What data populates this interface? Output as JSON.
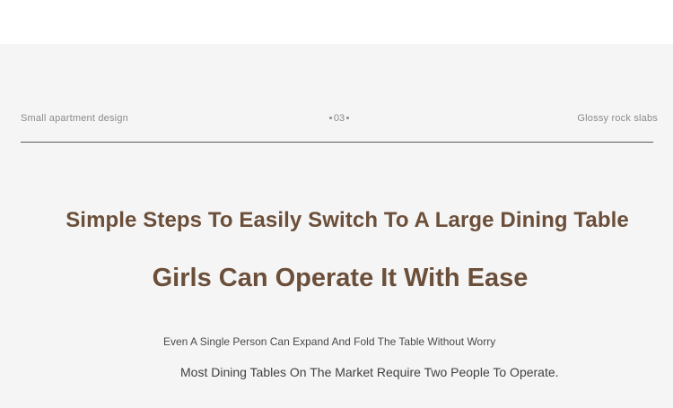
{
  "header": {
    "left_label": "Small apartment design",
    "page_number": "03",
    "right_label": "Glossy rock slabs"
  },
  "content": {
    "headline_primary": "Simple Steps To Easily Switch To A Large Dining Table",
    "headline_secondary": "Girls Can Operate It With Ease",
    "subtext_1": "Even A Single Person Can Expand And Fold The Table Without Worry",
    "subtext_2": "Most Dining Tables On The Market Require Two People To Operate."
  },
  "colors": {
    "headline": "#6b4f3a",
    "background": "#f5f5f5",
    "top_band": "#ffffff",
    "muted_text": "#8a8a8a"
  }
}
